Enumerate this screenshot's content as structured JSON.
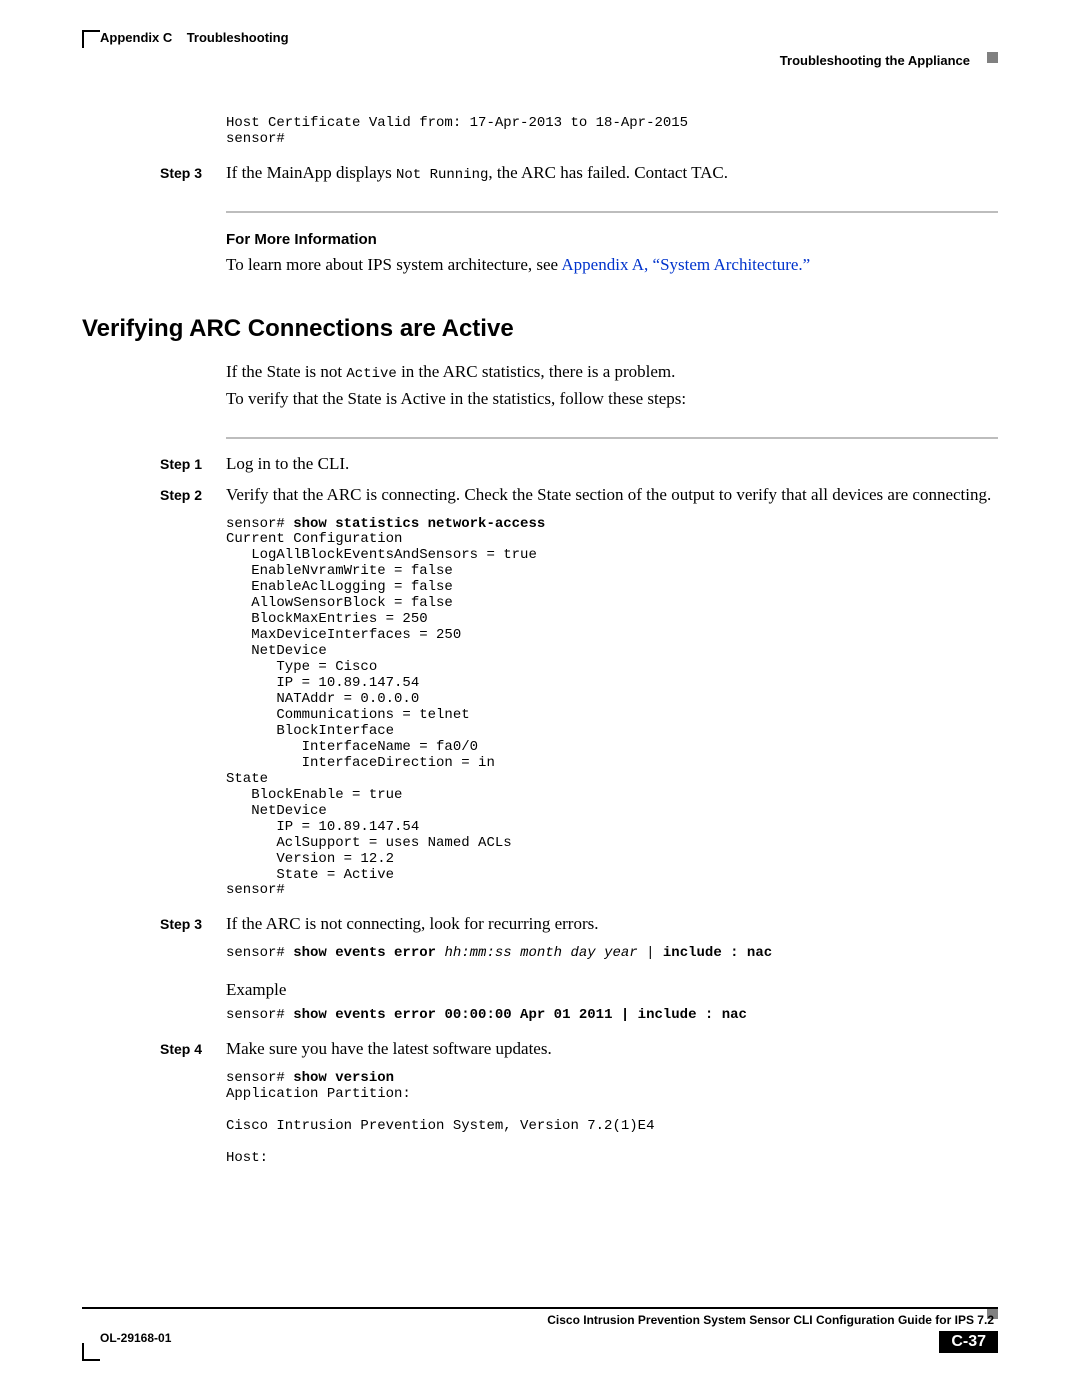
{
  "header": {
    "appendix": "Appendix C",
    "chapter": "Troubleshooting",
    "section": "Troubleshooting the Appliance"
  },
  "intro_code": "Host Certificate Valid from: 17-Apr-2013 to 18-Apr-2015\nsensor#",
  "intro_step": {
    "label": "Step 3",
    "before": "If the MainApp displays ",
    "mono": "Not Running",
    "after": ", the ARC has failed. Contact TAC."
  },
  "more_info": {
    "heading": "For More Information",
    "lead": "To learn more about IPS system architecture, see ",
    "link": "Appendix A, “System Architecture.”"
  },
  "h2": "Verifying ARC Connections are Active",
  "para1_before": "If the State is not ",
  "para1_mono": "Active",
  "para1_after": " in the ARC statistics, there is a problem.",
  "para2": "To verify that the State is Active in the statistics, follow these steps:",
  "steps": {
    "s1": {
      "label": "Step 1",
      "text": "Log in to the CLI."
    },
    "s2": {
      "label": "Step 2",
      "text": "Verify that the ARC is connecting. Check the State section of the output to verify that all devices are connecting."
    },
    "s3": {
      "label": "Step 3",
      "text": "If the ARC is not connecting, look for recurring errors."
    },
    "s4": {
      "label": "Step 4",
      "text": "Make sure you have the latest software updates."
    }
  },
  "code_s2": {
    "prompt": "sensor# ",
    "cmd": "show statistics network-access",
    "body": "Current Configuration\n   LogAllBlockEventsAndSensors = true\n   EnableNvramWrite = false\n   EnableAclLogging = false\n   AllowSensorBlock = false\n   BlockMaxEntries = 250\n   MaxDeviceInterfaces = 250\n   NetDevice\n      Type = Cisco\n      IP = 10.89.147.54\n      NATAddr = 0.0.0.0\n      Communications = telnet\n      BlockInterface\n         InterfaceName = fa0/0\n         InterfaceDirection = in\nState\n   BlockEnable = true\n   NetDevice\n      IP = 10.89.147.54\n      AclSupport = uses Named ACLs\n      Version = 12.2\n      State = Active\nsensor#"
  },
  "code_s3a": {
    "prompt": "sensor# ",
    "cmd": "show events error ",
    "args": "hh:mm:ss month day year",
    "tail": " | ",
    "tail_bold": "include : nac"
  },
  "example_label": "Example",
  "code_s3b": {
    "prompt": "sensor# ",
    "cmd": "show events error 00:00:00 Apr 01 2011 | include : nac"
  },
  "code_s4": {
    "prompt": "sensor# ",
    "cmd": "show version",
    "body": "Application Partition:\n\nCisco Intrusion Prevention System, Version 7.2(1)E4\n\nHost:"
  },
  "footer": {
    "guide": "Cisco Intrusion Prevention System Sensor CLI Configuration Guide for IPS 7.2",
    "doc": "OL-29168-01",
    "page": "C-37"
  }
}
